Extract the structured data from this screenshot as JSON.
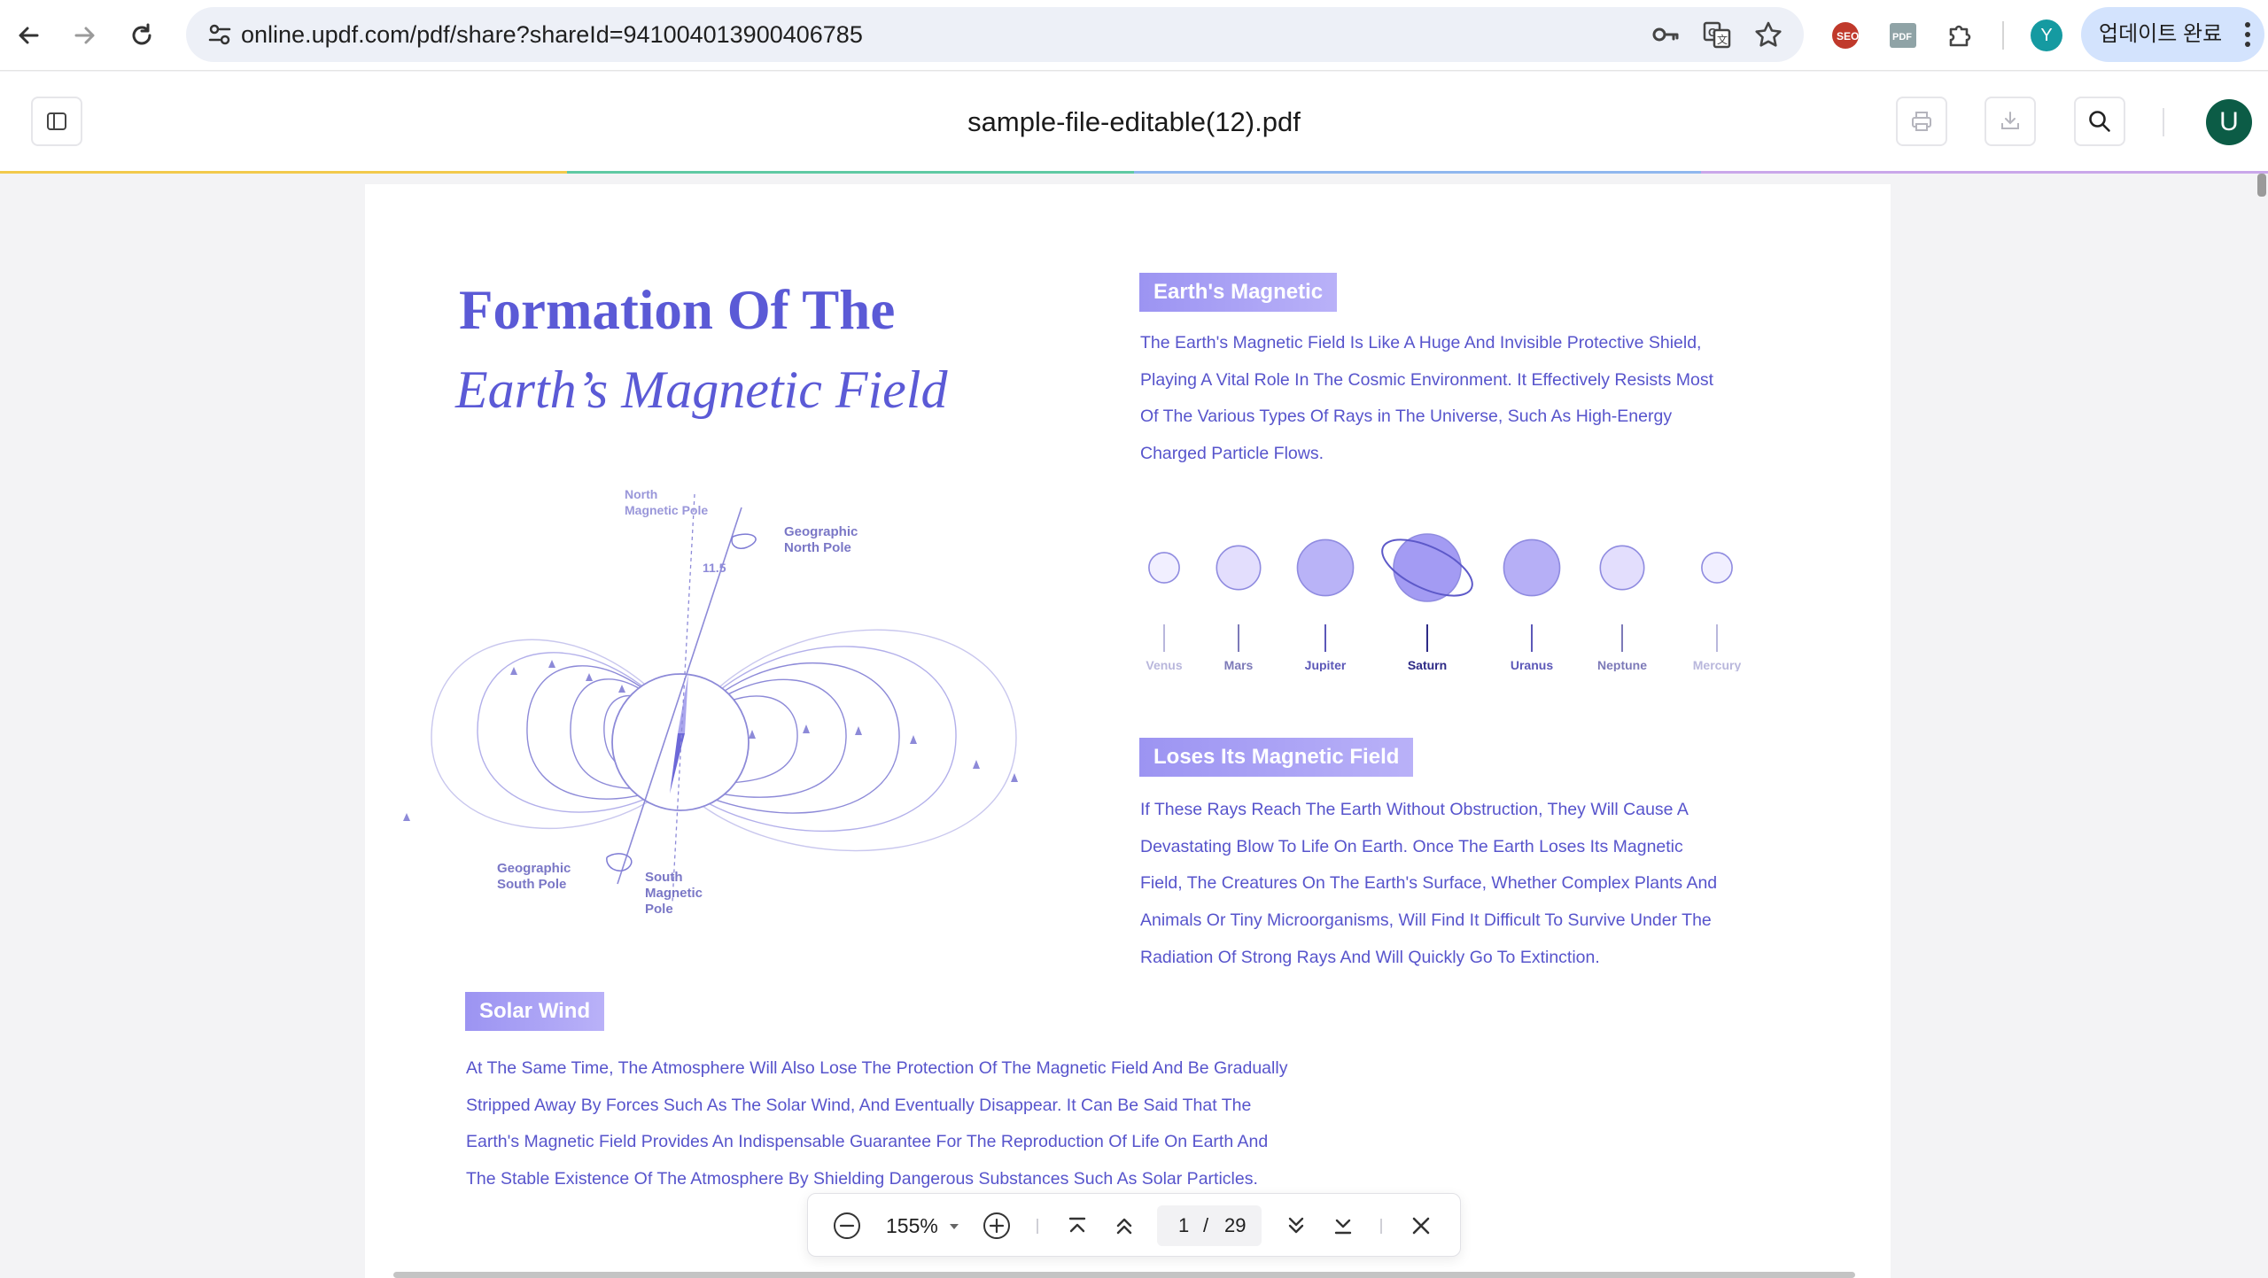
{
  "browser": {
    "url": "online.updf.com/pdf/share?shareId=941004013900406785",
    "profile_initial": "Y",
    "update_label": "업데이트 완료",
    "extensions": [
      "password-key-icon",
      "translate-icon",
      "bookmark-star-icon",
      "seo-extension-icon",
      "pdf-extension-icon",
      "extensions-puzzle-icon"
    ]
  },
  "viewer": {
    "doc_title": "sample-file-editable(12).pdf",
    "user_initial": "U",
    "zoom": "155%",
    "current_page": "1",
    "page_separator": "/",
    "total_pages": "29"
  },
  "document": {
    "title_line1": "Formation Of The",
    "title_line2": "Earth’s Magnetic Field",
    "diagram": {
      "north_magnetic_pole": [
        "North",
        "Magnetic Pole"
      ],
      "geographic_north_pole": [
        "Geographic",
        "North Pole"
      ],
      "angle": "11.5",
      "geographic_south_pole": [
        "Geographic",
        "South Pole"
      ],
      "south_magnetic_pole": [
        "South",
        "Magnetic",
        "Pole"
      ]
    },
    "magnetic": {
      "heading": "Earth's Magnetic",
      "lines": [
        "The Earth's Magnetic Field Is Like A Huge And Invisible Protective Shield,",
        "Playing A Vital Role In The Cosmic Environment. It Effectively Resists Most",
        "Of The Various Types Of Rays in The Universe, Such As High-Energy",
        "Charged Particle Flows."
      ]
    },
    "planets": [
      {
        "name": "Venus",
        "size": 0.45,
        "fill": "#f1efff",
        "label_color": "#b9b7dc"
      },
      {
        "name": "Mars",
        "size": 0.65,
        "fill": "#e3defd",
        "label_color": "#7d7ab8"
      },
      {
        "name": "Jupiter",
        "size": 0.83,
        "fill": "#b9b3f7",
        "label_color": "#5c58b8"
      },
      {
        "name": "Saturn",
        "size": 1.0,
        "fill": "#a39bf3",
        "label_color": "#2d2a86"
      },
      {
        "name": "Uranus",
        "size": 0.83,
        "fill": "#b6aff6",
        "label_color": "#5c58b8"
      },
      {
        "name": "Neptune",
        "size": 0.65,
        "fill": "#e3defd",
        "label_color": "#7d7ab8"
      },
      {
        "name": "Mercury",
        "size": 0.45,
        "fill": "#f1efff",
        "label_color": "#b9b7dc"
      }
    ],
    "loses": {
      "heading": "Loses Its Magnetic Field",
      "lines": [
        "If These Rays Reach The Earth Without Obstruction, They Will Cause A",
        "Devastating Blow To Life On Earth. Once The Earth Loses Its Magnetic",
        "Field, The Creatures On The Earth's Surface, Whether Complex Plants And",
        "Animals Or Tiny Microorganisms, Will Find It Difficult To Survive Under The",
        "Radiation Of Strong Rays And Will Quickly Go To Extinction."
      ]
    },
    "solar": {
      "heading": "Solar Wind",
      "lines": [
        "At The Same Time, The Atmosphere Will Also Lose The Protection Of The Magnetic Field And Be Gradually",
        "Stripped Away By Forces Such As The Solar Wind, And Eventually Disappear. It Can Be Said That The",
        "Earth's Magnetic Field Provides An Indispensable Guarantee For The Reproduction Of Life On Earth And",
        "The Stable Existence Of The Atmosphere By Shielding Dangerous Substances Such As Solar Particles."
      ]
    },
    "colors": {
      "accent": "#5b5ad6",
      "body_text": "#5754cc",
      "tag_start": "#9c94f2",
      "tag_end": "#b9b1f8"
    }
  }
}
